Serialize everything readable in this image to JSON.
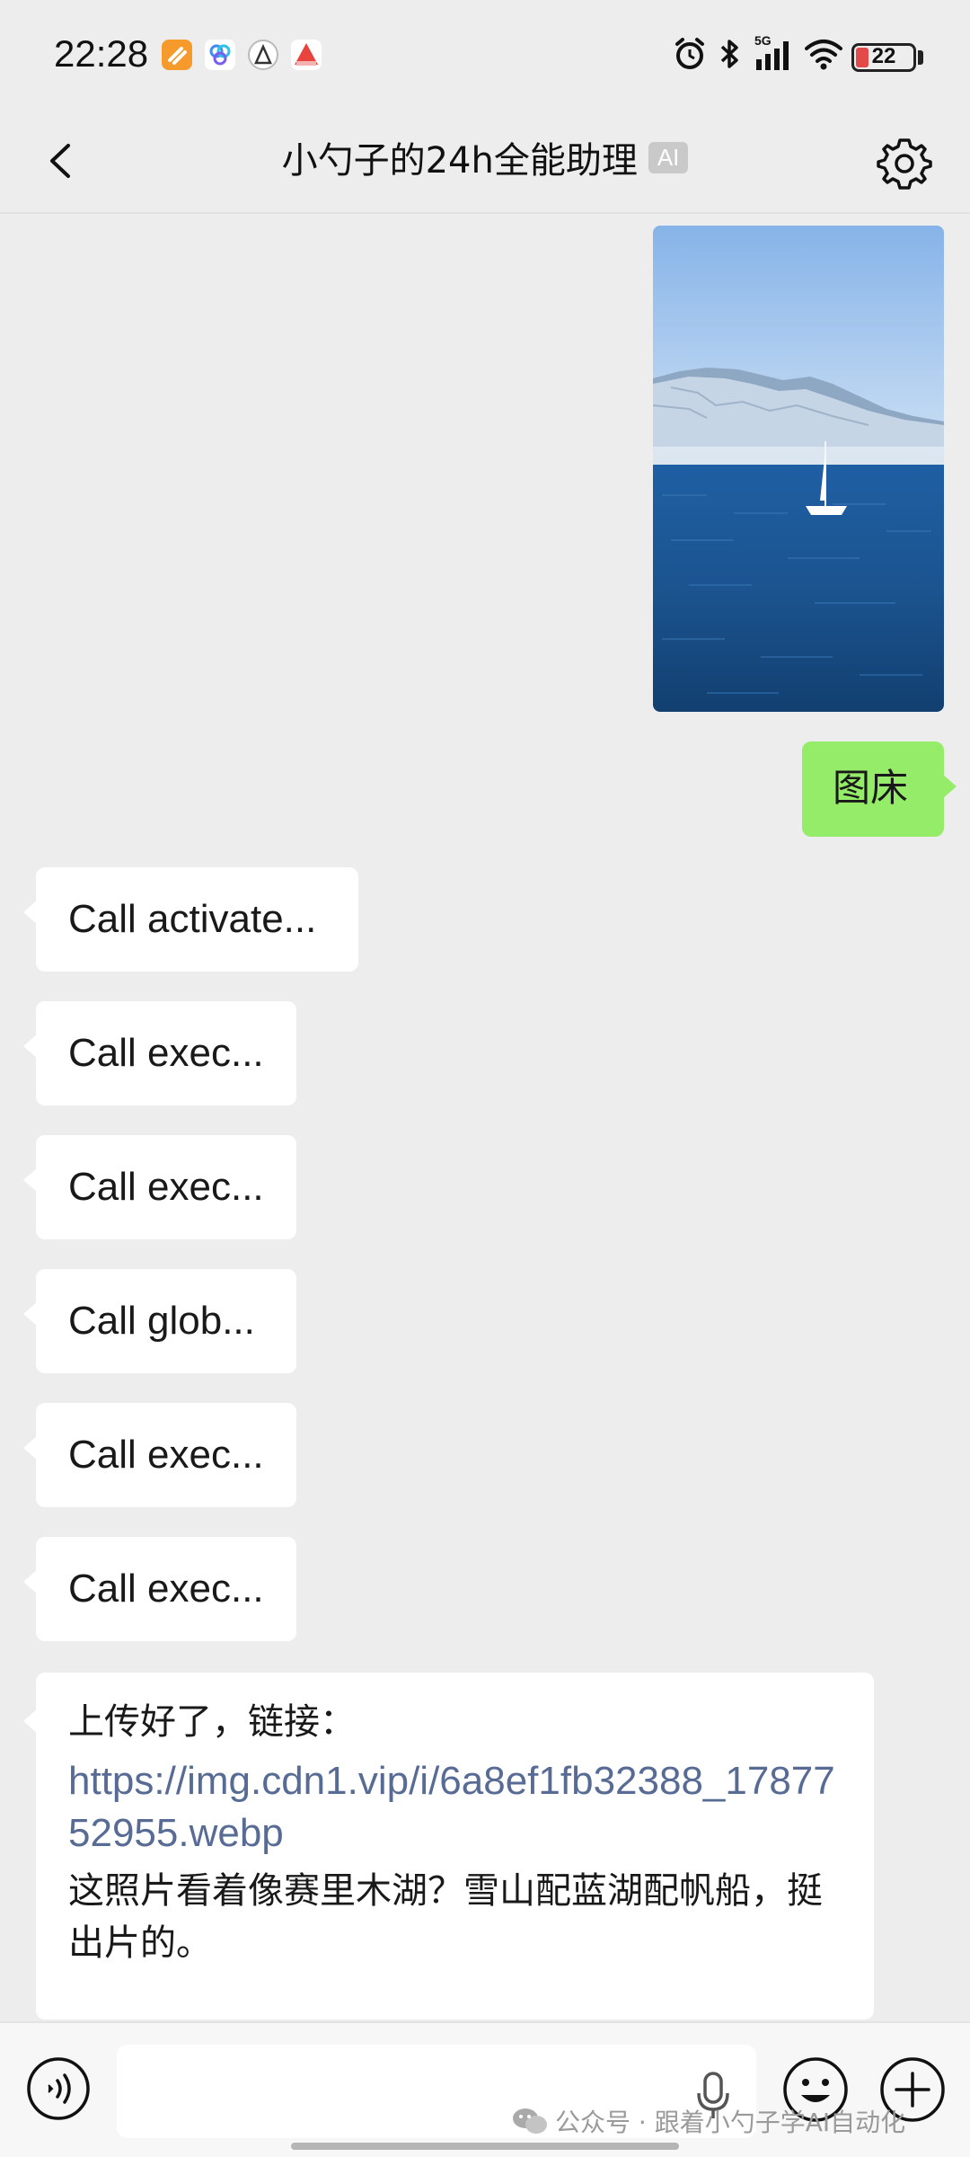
{
  "status_bar": {
    "time": "22:28",
    "battery": "22",
    "network": "5G",
    "app_icons": [
      "orange-app-icon",
      "blue-app-icon",
      "gray-app-icon",
      "red-app-icon"
    ],
    "system_icons": [
      "alarm-icon",
      "bluetooth-icon",
      "signal-icon",
      "wifi-icon",
      "battery-icon"
    ]
  },
  "header": {
    "title": "小勺子的24h全能助理",
    "badge": "AI"
  },
  "messages": {
    "user_image": "lake-photo",
    "user_text": "图床",
    "calls": [
      "Call activate...",
      "Call exec...",
      "Call exec...",
      "Call glob...",
      "Call exec...",
      "Call exec..."
    ],
    "reply": {
      "intro": "上传好了，链接：",
      "link": "https://img.cdn1.vip/i/6a8ef1fb32388_1787752955.webp",
      "body": "这照片看着像赛里木湖？雪山配蓝湖配帆船，挺出片的。"
    }
  },
  "input": {
    "value": "",
    "placeholder": ""
  },
  "watermark": "公众号 · 跟着小勺子学AI自动化",
  "colors": {
    "background": "#ededed",
    "outgoing_bubble": "#95ec69",
    "incoming_bubble": "#ffffff",
    "link": "#576b95"
  }
}
